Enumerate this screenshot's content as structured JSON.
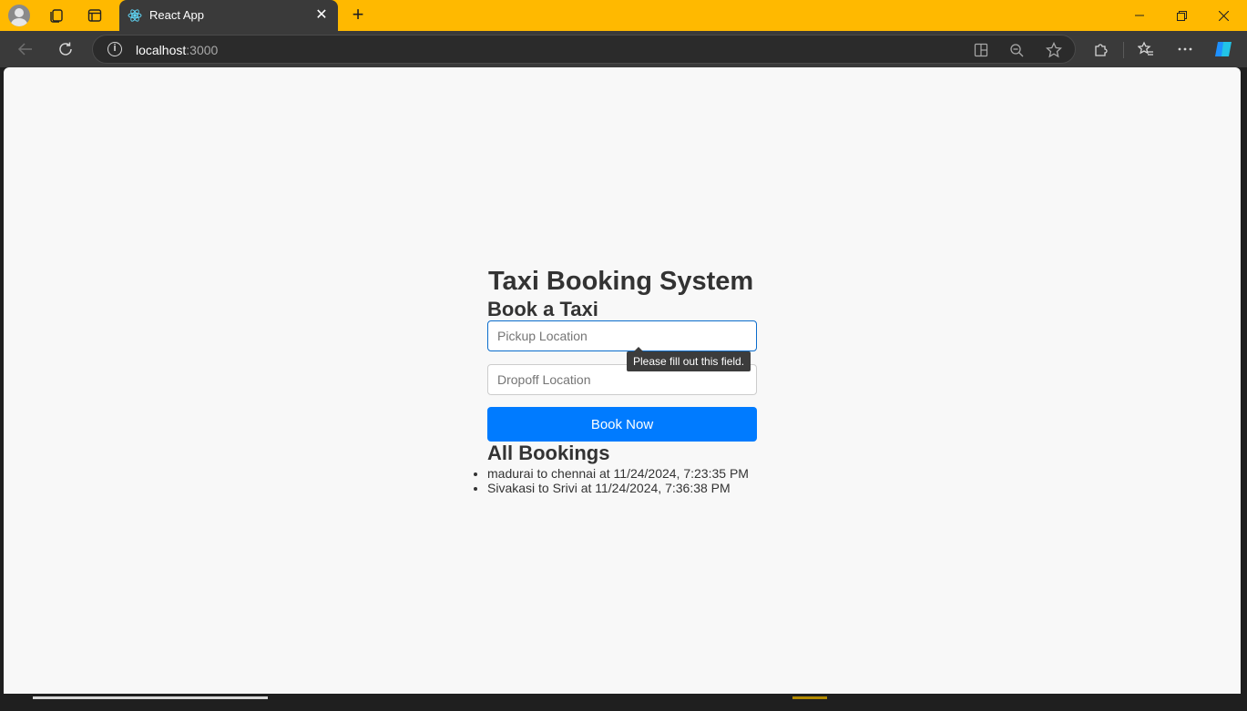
{
  "browser": {
    "tab": {
      "title": "React App",
      "close_icon": "close-icon"
    },
    "address": {
      "host": "localhost",
      "port": ":3000"
    },
    "colors": {
      "titlebar": "#ffb900",
      "toolbar": "#3a3a3a"
    }
  },
  "app": {
    "title": "Taxi Booking System",
    "form_heading": "Book a Taxi",
    "pickup_placeholder": "Pickup Location",
    "dropoff_placeholder": "Dropoff Location",
    "book_button": "Book Now",
    "validation_tooltip": "Please fill out this field.",
    "bookings_heading": "All Bookings",
    "bookings": [
      "madurai to chennai at 11/24/2024, 7:23:35 PM",
      "Sivakasi to Srivi at 11/24/2024, 7:36:38 PM"
    ],
    "colors": {
      "primary": "#007bff",
      "text": "#333333"
    }
  }
}
